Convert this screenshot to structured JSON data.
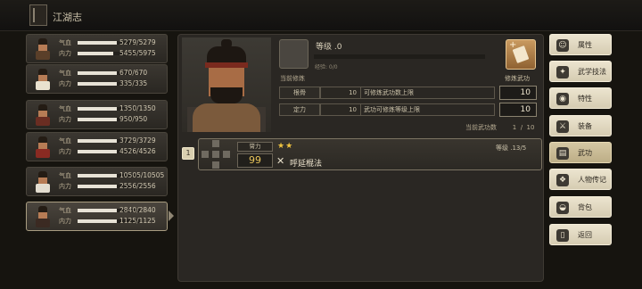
{
  "header": {
    "title": "江湖志",
    "book_icon": "book-icon"
  },
  "characters": [
    {
      "hp_label": "气血",
      "mp_label": "内力",
      "hp": "5279/5279",
      "mp": "5455/5975",
      "hp_frac": 1.0,
      "mp_frac": 0.913,
      "body_color": "#5a3f29",
      "selected": false
    },
    {
      "hp_label": "气血",
      "mp_label": "内力",
      "hp": "670/670",
      "mp": "335/335",
      "hp_frac": 1.0,
      "mp_frac": 1.0,
      "body_color": "#e9e1cf",
      "selected": false
    },
    {
      "hp_label": "气血",
      "mp_label": "内力",
      "hp": "1350/1350",
      "mp": "950/950",
      "hp_frac": 1.0,
      "mp_frac": 1.0,
      "body_color": "#6a2d22",
      "selected": false
    },
    {
      "hp_label": "气血",
      "mp_label": "内力",
      "hp": "3729/3729",
      "mp": "4526/4526",
      "hp_frac": 1.0,
      "mp_frac": 1.0,
      "body_color": "#8a2a22",
      "selected": false
    },
    {
      "hp_label": "气血",
      "mp_label": "内力",
      "hp": "10505/10505",
      "mp": "2556/2556",
      "hp_frac": 1.0,
      "mp_frac": 1.0,
      "body_color": "#e3ddd0",
      "selected": false
    },
    {
      "hp_label": "气血",
      "mp_label": "内力",
      "hp": "2840/2840",
      "mp": "1125/1125",
      "hp_frac": 1.0,
      "mp_frac": 1.0,
      "body_color": "#3b2a22",
      "selected": true
    }
  ],
  "detail": {
    "level_label": "等级 .0",
    "exp_label": "经验: 0/0",
    "exp_frac": 0,
    "current_style_label": "当前修炼",
    "practice_label": "修炼武功",
    "attributes": [
      {
        "name": "根骨",
        "value": "10",
        "desc": "可修炼武功数上限",
        "number": "10"
      },
      {
        "name": "定力",
        "value": "10",
        "desc": "武功可修炼等级上限",
        "number": "10"
      }
    ],
    "current_count": "当前武功数        1  /  10"
  },
  "skill": {
    "index": "1",
    "attr_label": "膂力",
    "attr_value": "99",
    "stars": "★★",
    "type_icon": "✕",
    "name": "呼延棍法",
    "level": "等级 .13/5"
  },
  "menu": [
    {
      "label": "属性",
      "icon": "person-icon",
      "glyph": "☺",
      "active": false
    },
    {
      "label": "武学技法",
      "icon": "martial-skills-icon",
      "glyph": "✦",
      "active": false
    },
    {
      "label": "特性",
      "icon": "trait-icon",
      "glyph": "◉",
      "active": false
    },
    {
      "label": "装备",
      "icon": "sword-icon",
      "glyph": "⚔",
      "active": false
    },
    {
      "label": "武功",
      "icon": "scroll-icon",
      "glyph": "▤",
      "active": true
    },
    {
      "label": "人物传记",
      "icon": "biography-icon",
      "glyph": "❖",
      "active": false
    },
    {
      "label": "背包",
      "icon": "bag-icon",
      "glyph": "◒",
      "active": false
    },
    {
      "label": "返回",
      "icon": "return-icon",
      "glyph": "▯",
      "active": false
    }
  ],
  "colors": {
    "accent_gold": "#e8c45a",
    "menu_bg": "#e3dac4",
    "panel_bg": "#2a2723"
  }
}
